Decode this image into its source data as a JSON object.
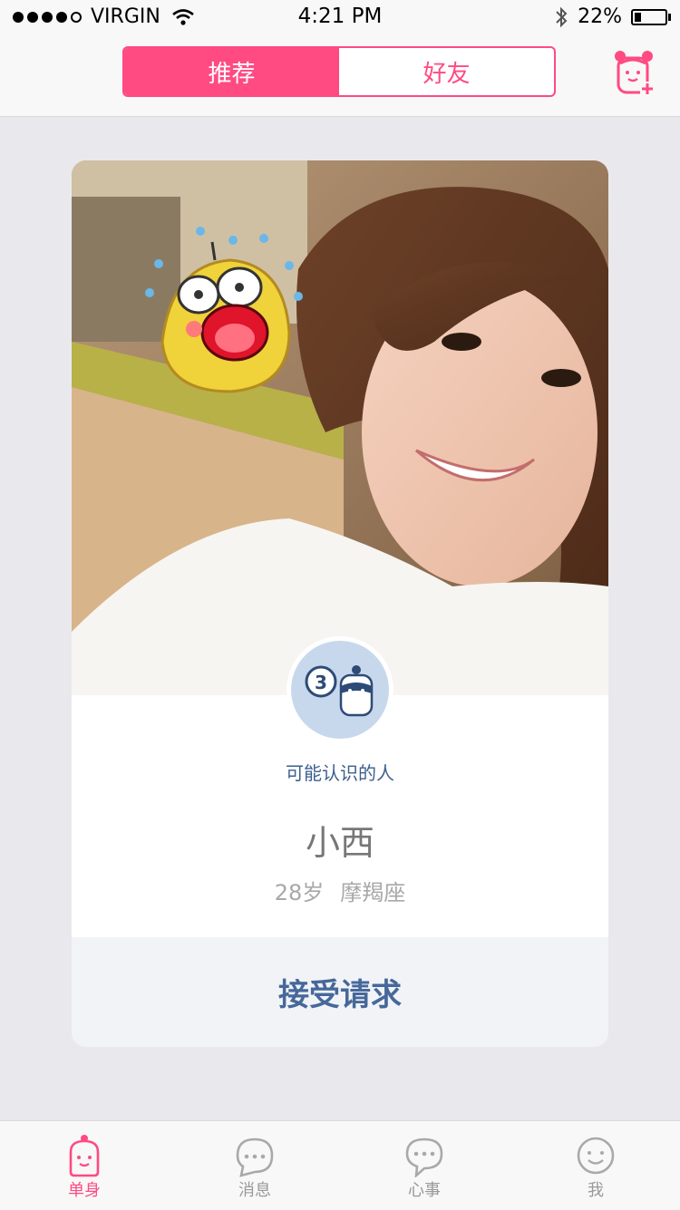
{
  "status": {
    "carrier": "VIRGIN",
    "time": "4:21 PM",
    "battery": "22%",
    "battery_level": 0.22,
    "signal_bars": 4
  },
  "nav": {
    "tabs": [
      "推荐",
      "好友"
    ],
    "active_tab": 0,
    "add_friend_icon": "add-friend-icon"
  },
  "card": {
    "mutual_count": "3",
    "maybe_know": "可能认识的人",
    "name": "小西",
    "age": "28岁",
    "zodiac": "摩羯座",
    "accept_label": "接受请求"
  },
  "tabbar": {
    "items": [
      {
        "label": "单身",
        "icon": "single-icon"
      },
      {
        "label": "消息",
        "icon": "message-icon"
      },
      {
        "label": "心事",
        "icon": "thoughts-icon"
      },
      {
        "label": "我",
        "icon": "me-icon"
      }
    ],
    "active": 0
  },
  "colors": {
    "accent": "#ff4a82",
    "blue_text": "#46689a",
    "background": "#e9e8ed"
  }
}
